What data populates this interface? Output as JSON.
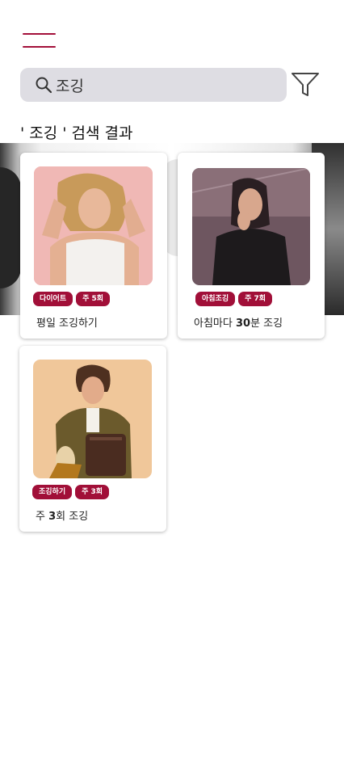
{
  "colors": {
    "accent": "#a10f38",
    "search_background": "#dedde3",
    "card_background": "#ffffff"
  },
  "header": {
    "menu_icon": "hamburger-menu-icon",
    "filter_icon": "filter-funnel-icon"
  },
  "search": {
    "icon": "search-icon",
    "value": "조깅"
  },
  "results": {
    "title": "' 조깅 ' 검색 결과"
  },
  "cards": [
    {
      "tags": [
        "다이어트",
        "주 5회"
      ],
      "label_prefix": "평일 조깅하기",
      "label_bold": "",
      "label_suffix": ""
    },
    {
      "tags": [
        "아침조깅",
        "주 7회"
      ],
      "label_prefix": "아침마다 ",
      "label_bold": "30",
      "label_suffix": "분 조깅"
    },
    {
      "tags": [
        "조깅하기",
        "주 3회"
      ],
      "label_prefix": "주 ",
      "label_bold": "3",
      "label_suffix": "회 조깅"
    }
  ]
}
